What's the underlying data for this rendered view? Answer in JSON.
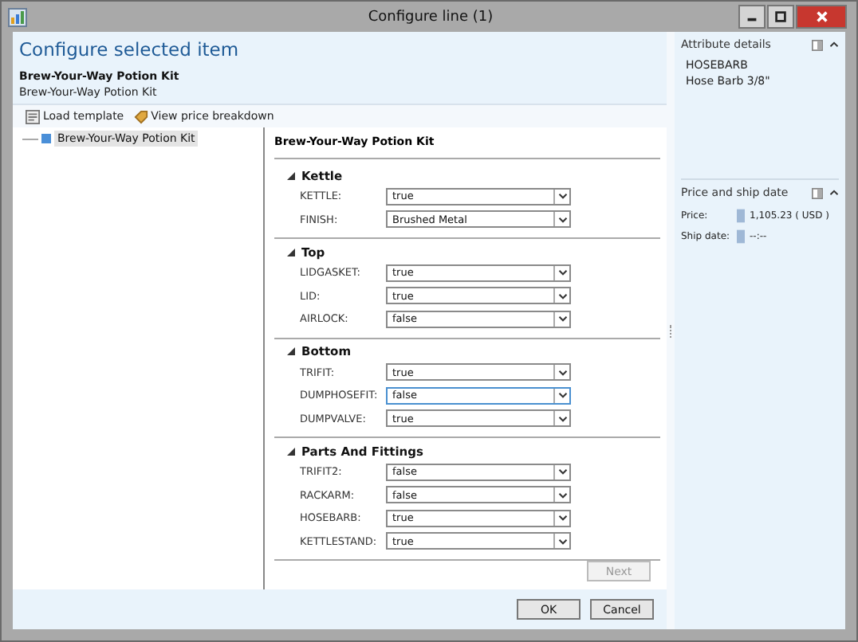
{
  "window": {
    "title": "Configure line (1)"
  },
  "heading": "Configure selected item",
  "item_name": "Brew-Your-Way Potion Kit",
  "item_description": "Brew-Your-Way Potion Kit",
  "toolbar": [
    "Load template",
    "View price breakdown"
  ],
  "tree": [
    {
      "label": "Brew-Your-Way Potion Kit",
      "selected": true
    }
  ],
  "config": {
    "title": "Brew-Your-Way Potion Kit",
    "groups": [
      {
        "name": "Kettle",
        "expanded": true,
        "fields": [
          {
            "label": "KETTLE:",
            "value": "true",
            "focused": false
          },
          {
            "label": "FINISH:",
            "value": "Brushed Metal",
            "focused": false
          }
        ]
      },
      {
        "name": "Top",
        "expanded": true,
        "fields": [
          {
            "label": "LIDGASKET:",
            "value": "true",
            "focused": false
          },
          {
            "label": "LID:",
            "value": "true",
            "focused": false
          },
          {
            "label": "AIRLOCK:",
            "value": "false",
            "focused": false
          }
        ]
      },
      {
        "name": "Bottom",
        "expanded": true,
        "fields": [
          {
            "label": "TRIFIT:",
            "value": "true",
            "focused": false
          },
          {
            "label": "DUMPHOSEFIT:",
            "value": "false",
            "focused": true
          },
          {
            "label": "DUMPVALVE:",
            "value": "true",
            "focused": false
          }
        ]
      },
      {
        "name": "Parts And Fittings",
        "expanded": true,
        "fields": [
          {
            "label": "TRIFIT2:",
            "value": "false",
            "focused": false
          },
          {
            "label": "RACKARM:",
            "value": "false",
            "focused": false
          },
          {
            "label": "HOSEBARB:",
            "value": "true",
            "focused": false
          },
          {
            "label": "KETTLESTAND:",
            "value": "true",
            "focused": false
          }
        ]
      }
    ],
    "next": {
      "label": "Next",
      "disabled": true
    }
  },
  "buttons": [
    {
      "label": "OK"
    },
    {
      "label": "Cancel"
    }
  ],
  "attribute_details": {
    "title": "Attribute details",
    "lines": [
      "HOSEBARB",
      "Hose Barb 3/8\""
    ]
  },
  "price": {
    "title": "Price and ship date",
    "rows": [
      {
        "label": "Price:",
        "value": "1,105.23 ( USD )"
      },
      {
        "label": "Ship date:",
        "value": "--:--"
      }
    ]
  }
}
